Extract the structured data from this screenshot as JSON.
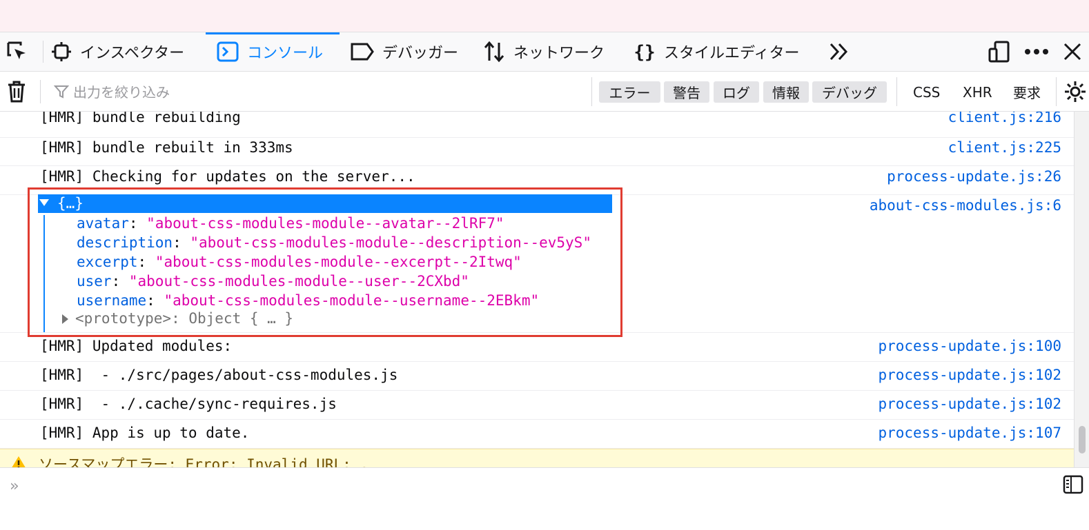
{
  "toolbar": {
    "tabs": [
      {
        "label": "インスペクター",
        "icon": "inspector-icon"
      },
      {
        "label": "コンソール",
        "icon": "console-icon",
        "selected": true
      },
      {
        "label": "デバッガー",
        "icon": "debugger-icon"
      },
      {
        "label": "ネットワーク",
        "icon": "network-icon"
      },
      {
        "label": "スタイルエディター",
        "icon": "style-editor-icon"
      }
    ],
    "more_icon": "chevron-double-right-icon",
    "responsive_icon": "responsive-design-icon",
    "menu_icon": "ellipsis-icon",
    "close_icon": "close-icon",
    "accent_color": "#0a84ff"
  },
  "filterbar": {
    "placeholder": "出力を絞り込み",
    "levels": [
      "エラー",
      "警告",
      "ログ",
      "情報",
      "デバッグ"
    ],
    "types": [
      "CSS",
      "XHR",
      "要求"
    ]
  },
  "console": {
    "messages_before": [
      {
        "text": "[HMR] bundle rebuilding",
        "location": "client.js:216"
      },
      {
        "text": "[HMR] bundle rebuilt in 333ms",
        "location": "client.js:225"
      },
      {
        "text": "[HMR] Checking for updates on the server...",
        "location": "process-update.js:26"
      }
    ],
    "object_message": {
      "summary": "{…}",
      "location": "about-css-modules.js:6",
      "properties": [
        {
          "key": "avatar",
          "value": "\"about-css-modules-module--avatar--2lRF7\""
        },
        {
          "key": "description",
          "value": "\"about-css-modules-module--description--ev5yS\""
        },
        {
          "key": "excerpt",
          "value": "\"about-css-modules-module--excerpt--2Itwq\""
        },
        {
          "key": "user",
          "value": "\"about-css-modules-module--user--2CXbd\""
        },
        {
          "key": "username",
          "value": "\"about-css-modules-module--username--2EBkm\""
        }
      ],
      "prototype": "<prototype>: Object { … }"
    },
    "messages_after": [
      {
        "text": "[HMR] Updated modules:",
        "location": "process-update.js:100"
      },
      {
        "text": "[HMR]  - ./src/pages/about-css-modules.js",
        "location": "process-update.js:102"
      },
      {
        "text": "[HMR]  - ./.cache/sync-requires.js",
        "location": "process-update.js:102"
      },
      {
        "text": "[HMR] App is up to date.",
        "location": "process-update.js:107"
      }
    ],
    "warning": "ソースマップエラー: Error: Invalid URL: ."
  },
  "input": {
    "prompt": "»"
  }
}
